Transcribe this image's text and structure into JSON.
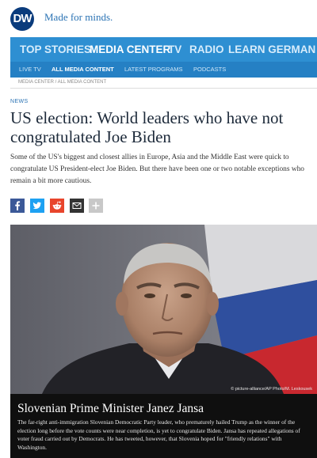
{
  "brand": {
    "logo_text": "DW",
    "tagline": "Made for minds."
  },
  "main_nav": {
    "items": [
      {
        "label": "TOP STORIES"
      },
      {
        "label": "MEDIA CENTER"
      },
      {
        "label": "TV"
      },
      {
        "label": "RADIO"
      },
      {
        "label": "LEARN GERMAN"
      }
    ],
    "active": "MEDIA CENTER"
  },
  "sub_nav": {
    "items": [
      {
        "label": "LIVE TV"
      },
      {
        "label": "ALL MEDIA CONTENT"
      },
      {
        "label": "LATEST PROGRAMS"
      },
      {
        "label": "PODCASTS"
      }
    ],
    "active": "ALL MEDIA CONTENT"
  },
  "breadcrumb": "MEDIA CENTER / ALL MEDIA CONTENT",
  "article": {
    "kicker": "NEWS",
    "title": "US election: World leaders who have not congratulated Joe Biden",
    "lead": "Some of the US's biggest and closest allies in Europe, Asia and the Middle East were quick to congratulate US President-elect Joe Biden. But there have been one or two notable exceptions who remain a bit more cautious."
  },
  "share_buttons": [
    {
      "name": "facebook",
      "icon": "facebook-icon",
      "color": "#3b5998"
    },
    {
      "name": "twitter",
      "icon": "twitter-icon",
      "color": "#1da1f2"
    },
    {
      "name": "reddit",
      "icon": "reddit-icon",
      "color": "#e8452c"
    },
    {
      "name": "email",
      "icon": "mail-icon",
      "color": "#333333"
    },
    {
      "name": "more",
      "icon": "plus-icon",
      "color": "#c8c8c8"
    }
  ],
  "photo": {
    "credit": "© picture-alliance/AP Photo/M. Leskousek",
    "caption_title": "Slovenian Prime Minister Janez Jansa",
    "caption_text": "The far-right anti-immigration Slovenian Democratic Party leader, who prematurely hailed Trump as the winner of the election long before the vote counts were near completion, is yet to congratulate Biden. Jansa has repeated allegations of voter fraud carried out by Democrats. He has tweeted, however, that Slovenia hoped for \"friendly relations\" with Washington."
  },
  "colors": {
    "brand_blue": "#0a3b7c",
    "nav_blue": "#2e8fd2",
    "subnav_blue": "#2580c4",
    "caption_bg": "#0f0f0f"
  }
}
